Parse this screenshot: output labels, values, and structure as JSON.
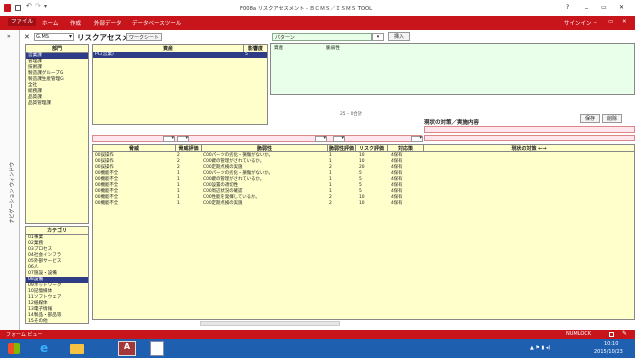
{
  "window": {
    "title": "F008a リスクアセスメント - ＢＣＭＳ／ＩＳＭＳ TOOL",
    "help": "?",
    "minimize": "_",
    "restore": "▭",
    "close": "✕",
    "min2": "_",
    "restore2": "▭",
    "close2": "✕"
  },
  "app": {
    "sign_in": "サインイン"
  },
  "ribbon": {
    "tabs": [
      "ファイル",
      "ホーム",
      "作成",
      "外部データ",
      "データベースツール"
    ]
  },
  "nav_pane": {
    "label": "ナビゲーション ウィンドウ",
    "toggle": "»"
  },
  "form": {
    "close": "✕",
    "code": "G.MS",
    "title": "リスクアセスメント",
    "worksheet_button": "ワークシート"
  },
  "dept": {
    "header": "部門",
    "items": [
      "営業課",
      "管理課",
      "技術課",
      "製造課グループG",
      "製造課生産管理G",
      "全社",
      "総務課",
      "品質課",
      "品質管理課"
    ],
    "selected": 0
  },
  "asset": {
    "col_asset": "資産",
    "col_importance": "影響度",
    "rows": [
      {
        "asset": "PC(営業)",
        "importance": "5"
      }
    ]
  },
  "pattern": {
    "label": "パターン",
    "insert_button": "挿入",
    "col_asset": "資産",
    "col_vuln": "脆弱性"
  },
  "category": {
    "header": "カテゴリ",
    "items": [
      "01事業",
      "02業務",
      "03プロセス",
      "04社会インフラ",
      "05外部サービス",
      "06人",
      "07施設・設備",
      "08設備",
      "09ネットワーク",
      "10記憶媒体",
      "11ソフトウェア",
      "12紙媒体",
      "13電子情報",
      "14製品・部品等",
      "15その他"
    ],
    "selected": 7
  },
  "measures": {
    "label": "現状の対策／実施内容",
    "save_button": "保存",
    "delete_button": "削除",
    "count": "25 – 0合計"
  },
  "threat_table": {
    "headers": [
      "脅威",
      "脅威評価",
      "脆弱性",
      "脆弱性評価",
      "リスク評価",
      "対応策",
      "現状の対策 ←→"
    ],
    "rows": [
      {
        "threat": "00誤操作",
        "t_eval": "2",
        "vuln": "C00パーツの劣化・損傷がないか。",
        "v_eval": "1",
        "risk": "10",
        "resp": "4保有"
      },
      {
        "threat": "00誤操作",
        "t_eval": "2",
        "vuln": "C00鍵の管理がされているか。",
        "v_eval": "1",
        "risk": "10",
        "resp": "4保有"
      },
      {
        "threat": "00誤操作",
        "t_eval": "2",
        "vuln": "C00定期点検の実施",
        "v_eval": "2",
        "risk": "20",
        "resp": "4保有"
      },
      {
        "threat": "00機能不全",
        "t_eval": "1",
        "vuln": "C00パーツの劣化・損傷がないか。",
        "v_eval": "1",
        "risk": "5",
        "resp": "4保有"
      },
      {
        "threat": "00機能不全",
        "t_eval": "1",
        "vuln": "C00鍵の管理がされているか。",
        "v_eval": "1",
        "risk": "5",
        "resp": "4保有"
      },
      {
        "threat": "00機能不全",
        "t_eval": "1",
        "vuln": "C00設置の適切性",
        "v_eval": "1",
        "risk": "5",
        "resp": "4保有"
      },
      {
        "threat": "00機能不全",
        "t_eval": "1",
        "vuln": "C00周辺状況の確認",
        "v_eval": "1",
        "risk": "5",
        "resp": "4保有"
      },
      {
        "threat": "00機能不全",
        "t_eval": "1",
        "vuln": "C00性能を発揮しているか。",
        "v_eval": "2",
        "risk": "10",
        "resp": "4保有"
      },
      {
        "threat": "00機能不全",
        "t_eval": "1",
        "vuln": "C00定期点検の実施",
        "v_eval": "2",
        "risk": "10",
        "resp": "4保有"
      }
    ]
  },
  "status": {
    "left": "フォーム ビュー",
    "numlock": "NUMLOCK"
  },
  "taskbar": {
    "time": "10:10",
    "date": "2015/10/23"
  },
  "colors": {
    "accent": "#c8151b",
    "taskbar": "#1f5fb0",
    "yellow": "#ffffcc",
    "green": "#eaffea",
    "pink": "#ffe6ee"
  }
}
